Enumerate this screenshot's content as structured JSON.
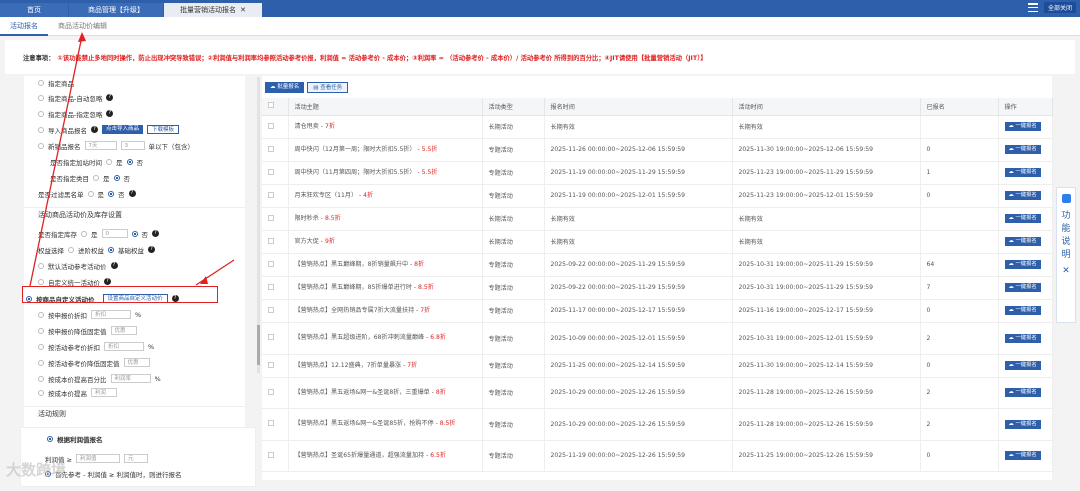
{
  "top_tabs": [
    {
      "label": "首页"
    },
    {
      "label": "商品管理【升级】"
    },
    {
      "label": "批量营销活动报名"
    }
  ],
  "close_all": "全部关闭",
  "sub_tabs": [
    "活动报名",
    "商品活动价编辑"
  ],
  "notice": {
    "label": "注意事项：",
    "text": "①该功能禁止多地同时操作，防止出现冲突导致错误；②利润值与利润率均参照活动参考价报，利润值 = 活动参考价 - 成本价；③利润率 = （活动参考价 - 成本价）/ 活动参考价 所得到的百分比；④JIT请使用【批量营销活动（JIT）】"
  },
  "left": {
    "o1": "指定商品",
    "o2": "指定商品-自动忽略",
    "o3": "指定商品-指定忽略",
    "o4": "导入商品报名",
    "o4_btn1": "点击导入商品",
    "o4_btn2": "下载模板",
    "o5": "新销品报名",
    "o5_v1": "7天",
    "o5_v2": "3",
    "o5_v3": "单以下（包含）",
    "o6": "是否指定加站时间",
    "o7": "是否指定类目",
    "o8": "是否过滤黑名单",
    "yes": "是",
    "no": "否",
    "sec1": "活动商品活动价及库存设置",
    "stock": "是否指定库存",
    "stock_v": "0",
    "rights": "权益选择",
    "rights_a": "进阶权益",
    "rights_b": "基础权益",
    "p1": "默认活动参考活动价",
    "p2": "自定义统一活动价",
    "p3": "按商品自定义活动价",
    "p3_btn": "设置商品自定义活动价",
    "p4": "按申报价折扣",
    "p4_ph": "折扣",
    "pct": "%",
    "p5": "按申报价降低固定值",
    "p5_ph": "优惠",
    "p6": "按活动参考价折扣",
    "p6_ph": "折扣",
    "p7": "按活动参考价降低固定值",
    "p7_ph": "优惠",
    "p8": "按成本价提高百分比",
    "p8_ph": "利润率",
    "p9": "按成本价提高",
    "p9_ph": "利润",
    "sec2": "活动规则",
    "rule1": "根据利润值报名",
    "rule_lbl": "利润值 ≥",
    "rule_ph": "利润值",
    "rule_unit": "元",
    "rule2": "首先参考 - 利润值 ≥ 利润值时，则进行报名"
  },
  "main": {
    "btn_batch": "批量报名",
    "btn_task": "查看任务",
    "headers": [
      "活动主题",
      "活动类型",
      "报名时间",
      "活动时间",
      "已报名",
      "操作"
    ],
    "action": "一键报名",
    "rows": [
      {
        "t": "清仓甩卖 - ",
        "h": "7折",
        "type": "长期活动",
        "sign": "长期有效",
        "act": "长期有效",
        "n": ""
      },
      {
        "t": "周中快闪（12月第一周；限时大折扣5.5折） - ",
        "h": "5.5折",
        "type": "专题活动",
        "sign": "2025-11-26 00:00:00~2025-12-06 15:59:59",
        "act": "2025-11-30 19:00:00~2025-12-06 15:59:59",
        "n": "0"
      },
      {
        "t": "周中快闪（11月第四周；限时大折扣5.5折） - ",
        "h": "5.5折",
        "type": "专题活动",
        "sign": "2025-11-19 00:00:00~2025-11-29 15:59:59",
        "act": "2025-11-23 19:00:00~2025-11-29 15:59:59",
        "n": "1"
      },
      {
        "t": "月末狂欢专区（11月） - ",
        "h": "4折",
        "type": "专题活动",
        "sign": "2025-11-19 00:00:00~2025-12-01 15:59:59",
        "act": "2025-11-23 19:00:00~2025-12-01 15:59:59",
        "n": "0"
      },
      {
        "t": "限时秒杀 - ",
        "h": "8.5折",
        "type": "长期活动",
        "sign": "长期有效",
        "act": "长期有效",
        "n": ""
      },
      {
        "t": "官方大促 - ",
        "h": "9折",
        "type": "长期活动",
        "sign": "长期有效",
        "act": "长期有效",
        "n": ""
      },
      {
        "t": "【营销热点】黑五巅峰期，8折销量飙升中 - ",
        "h": "8折",
        "type": "专题活动",
        "sign": "2025-09-22 00:00:00~2025-11-29 15:59:59",
        "act": "2025-10-31 19:00:00~2025-11-29 15:59:59",
        "n": "64"
      },
      {
        "t": "【营销热点】黑五巅峰期，85折爆单进行时 - ",
        "h": "8.5折",
        "type": "专题活动",
        "sign": "2025-09-22 00:00:00~2025-11-29 15:59:59",
        "act": "2025-10-31 19:00:00~2025-11-29 15:59:59",
        "n": "7"
      },
      {
        "t": "【营销热点】全网热销品专属7折大流量扶持 - ",
        "h": "7折",
        "type": "专题活动",
        "sign": "2025-11-17 00:00:00~2025-12-17 15:59:59",
        "act": "2025-11-16 19:00:00~2025-12-17 15:59:59",
        "n": "0"
      },
      {
        "t": "【营销热点】黑五超级进阶，68折冲刺流量巅峰 - ",
        "h": "6.8折",
        "type": "专题活动",
        "sign": "2025-10-09 00:00:00~2025-12-01 15:59:59",
        "act": "2025-10-31 19:00:00~2025-12-01 15:59:59",
        "n": "2"
      },
      {
        "t": "【营销热点】12.12盛典，7折单量暴涨 - ",
        "h": "7折",
        "type": "专题活动",
        "sign": "2025-11-25 00:00:00~2025-12-14 15:59:59",
        "act": "2025-11-30 19:00:00~2025-12-14 15:59:59",
        "n": "0"
      },
      {
        "t": "【营销热点】黑五返场&网一&圣诞8折，三重爆单 - ",
        "h": "8折",
        "type": "专题活动",
        "sign": "2025-10-29 00:00:00~2025-12-26 15:59:59",
        "act": "2025-11-28 19:00:00~2025-12-26 15:59:59",
        "n": "2"
      },
      {
        "t": "【营销热点】黑五返场&网一&圣诞85折，抢购不停 - ",
        "h": "8.5折",
        "type": "专题活动",
        "sign": "2025-10-29 00:00:00~2025-12-26 15:59:59",
        "act": "2025-11-28 19:00:00~2025-12-26 15:59:59",
        "n": "2"
      },
      {
        "t": "【营销热点】圣诞65折爆量通道，超强流量加持 - ",
        "h": "6.5折",
        "type": "专题活动",
        "sign": "2025-11-19 00:00:00~2025-12-26 15:59:59",
        "act": "2025-11-25 19:00:00~2025-12-26 15:59:59",
        "n": "0"
      }
    ]
  },
  "side_panel": {
    "chars": [
      "功",
      "能",
      "说",
      "明"
    ],
    "close": "✕"
  },
  "watermark": "大数跨境"
}
